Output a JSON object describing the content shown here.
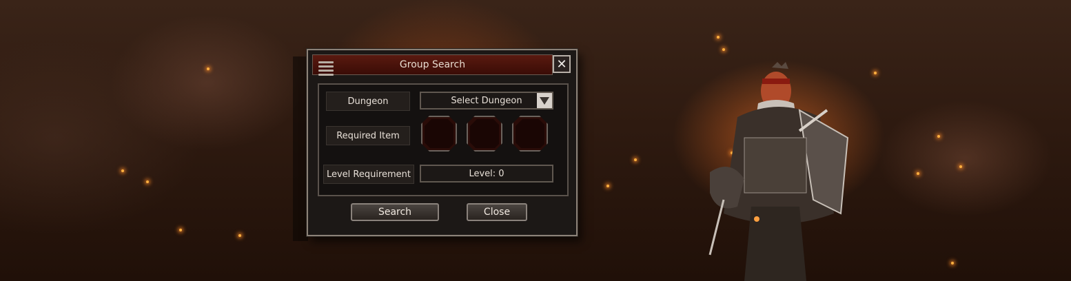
{
  "dialog": {
    "title": "Group Search",
    "rows": {
      "dungeon_label": "Dungeon",
      "dungeon_value": "Select Dungeon",
      "required_item_label": "Required Item",
      "level_label": "Level Requirement",
      "level_value": "Level: 0"
    },
    "buttons": {
      "search": "Search",
      "close": "Close"
    },
    "close_glyph": "✕"
  },
  "theme": {
    "title_bar": "#4a140c",
    "panel_border": "#8c8278",
    "ember": "#ffb040"
  }
}
